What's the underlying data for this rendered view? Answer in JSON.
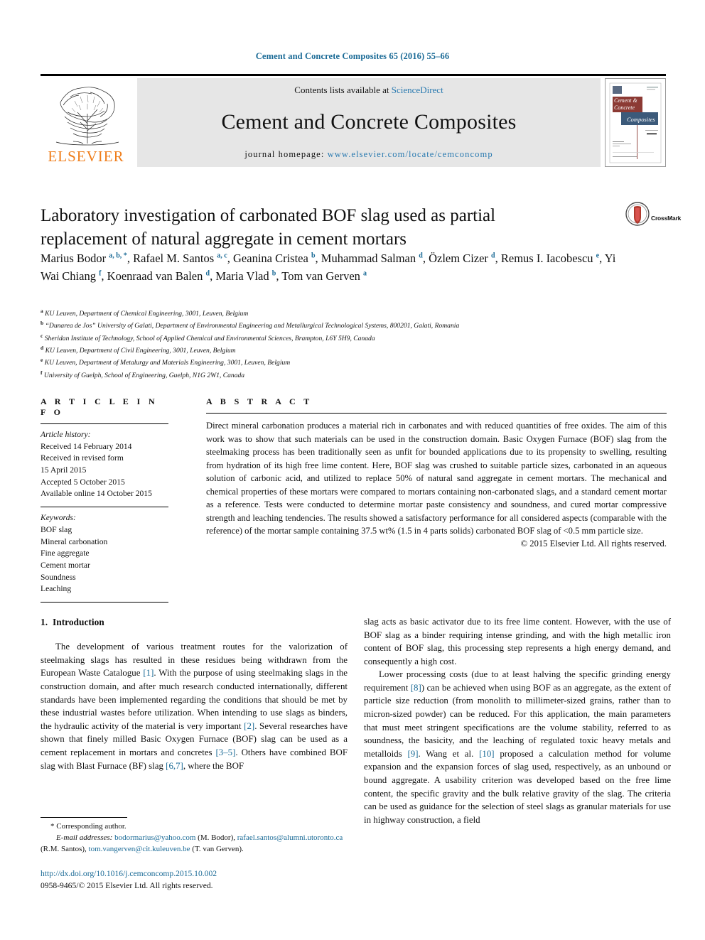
{
  "running_head": "Cement and Concrete Composites 65 (2016) 55–66",
  "masthead": {
    "publisher": "ELSEVIER",
    "contents_prefix": "Contents lists available at ",
    "contents_link": "ScienceDirect",
    "journal_title": "Cement and Concrete Composites",
    "homepage_prefix": "journal homepage: ",
    "homepage_url": "www.elsevier.com/locate/cemconcomp",
    "cover_line1": "Cement &",
    "cover_line2": "Concrete",
    "cover_line3": "Composites"
  },
  "article": {
    "title": "Laboratory investigation of carbonated BOF slag used as partial replacement of natural aggregate in cement mortars",
    "crossmark_label": "CrossMark",
    "authors_html": "Marius Bodor <sup>a, b, *</sup>, Rafael M. Santos <sup>a, c</sup>, Geanina Cristea <sup>b</sup>, Muhammad Salman <sup>d</sup>, Özlem Cizer <sup>d</sup>, Remus I. Iacobescu <sup>e</sup>, Yi Wai Chiang <sup>f</sup>, Koenraad van Balen <sup>d</sup>, Maria Vlad <sup>b</sup>, Tom van Gerven <sup>a</sup>",
    "affiliations": [
      {
        "marker": "a",
        "text": "KU Leuven, Department of Chemical Engineering, 3001, Leuven, Belgium"
      },
      {
        "marker": "b",
        "text": "“Dunarea de Jos” University of Galati, Department of Environmental Engineering and Metallurgical Technological Systems, 800201, Galati, Romania"
      },
      {
        "marker": "c",
        "text": "Sheridan Institute of Technology, School of Applied Chemical and Environmental Sciences, Brampton, L6Y 5H9, Canada"
      },
      {
        "marker": "d",
        "text": "KU Leuven, Department of Civil Engineering, 3001, Leuven, Belgium"
      },
      {
        "marker": "e",
        "text": "KU Leuven, Department of Metalurgy and Materials Engineering, 3001, Leuven, Belgium"
      },
      {
        "marker": "f",
        "text": "University of Guelph, School of Engineering, Guelph, N1G 2W1, Canada"
      }
    ]
  },
  "article_info": {
    "heading": "A R T I C L E   I N F O",
    "history_label": "Article history:",
    "history_lines": [
      "Received 14 February 2014",
      "Received in revised form",
      "15 April 2015",
      "Accepted 5 October 2015",
      "Available online 14 October 2015"
    ],
    "keywords_label": "Keywords:",
    "keywords": [
      "BOF slag",
      "Mineral carbonation",
      "Fine aggregate",
      "Cement mortar",
      "Soundness",
      "Leaching"
    ]
  },
  "abstract": {
    "heading": "A B S T R A C T",
    "text": "Direct mineral carbonation produces a material rich in carbonates and with reduced quantities of free oxides. The aim of this work was to show that such materials can be used in the construction domain. Basic Oxygen Furnace (BOF) slag from the steelmaking process has been traditionally seen as unfit for bounded applications due to its propensity to swelling, resulting from hydration of its high free lime content. Here, BOF slag was crushed to suitable particle sizes, carbonated in an aqueous solution of carbonic acid, and utilized to replace 50% of natural sand aggregate in cement mortars. The mechanical and chemical properties of these mortars were compared to mortars containing non-carbonated slags, and a standard cement mortar as a reference. Tests were conducted to determine mortar paste consistency and soundness, and cured mortar compressive strength and leaching tendencies. The results showed a satisfactory performance for all considered aspects (comparable with the reference) of the mortar sample containing 37.5 wt% (1.5 in 4 parts solids) carbonated BOF slag of <0.5 mm particle size.",
    "copyright": "© 2015 Elsevier Ltd. All rights reserved."
  },
  "body": {
    "section_number": "1.",
    "section_title": "Introduction",
    "left_paragraph_html": "The development of various treatment routes for the valorization of steelmaking slags has resulted in these residues being withdrawn from the European Waste Catalogue <span class=\"ref\">[1]</span>. With the purpose of using steelmaking slags in the construction domain, and after much research conducted internationally, different standards have been implemented regarding the conditions that should be met by these industrial wastes before utilization. When intending to use slags as binders, the hydraulic activity of the material is very important <span class=\"ref\">[2]</span>. Several researches have shown that finely milled Basic Oxygen Furnace (BOF) slag can be used as a cement replacement in mortars and concretes <span class=\"ref\">[3–5]</span>. Others have combined BOF slag with Blast Furnace (BF) slag <span class=\"ref\">[6,7]</span>, where the BOF",
    "right_paragraph1_html": "slag acts as basic activator due to its free lime content. However, with the use of BOF slag as a binder requiring intense grinding, and with the high metallic iron content of BOF slag, this processing step represents a high energy demand, and consequently a high cost.",
    "right_paragraph2_html": "Lower processing costs (due to at least halving the specific grinding energy requirement <span class=\"ref\">[8]</span>) can be achieved when using BOF as an aggregate, as the extent of particle size reduction (from monolith to millimeter-sized grains, rather than to micron-sized powder) can be reduced. For this application, the main parameters that must meet stringent specifications are the volume stability, referred to as soundness, the basicity, and the leaching of regulated toxic heavy metals and metalloids <span class=\"ref\">[9]</span>. Wang et al. <span class=\"ref\">[10]</span> proposed a calculation method for volume expansion and the expansion forces of slag used, respectively, as an unbound or bound aggregate. A usability criterion was developed based on the free lime content, the specific gravity and the bulk relative gravity of the slag. The criteria can be used as guidance for the selection of steel slags as granular materials for use in highway construction, a field"
  },
  "footnote": {
    "corresponding": "* Corresponding author.",
    "email_label": "E-mail addresses:",
    "email1": "bodormarius@yahoo.com",
    "email1_owner": "(M. Bodor),",
    "email2": "rafael.santos@alumni.utoronto.ca",
    "email2_owner": "(R.M. Santos),",
    "email3": "tom.vangerven@cit.kuleuven.be",
    "email3_owner": "(T. van Gerven)."
  },
  "bottom": {
    "doi": "http://dx.doi.org/10.1016/j.cemconcomp.2015.10.002",
    "issn_line": "0958-9465/© 2015 Elsevier Ltd. All rights reserved."
  },
  "colors": {
    "link": "#1a6a96",
    "sciencedirect": "#2a7ab0",
    "elsevier_orange": "#ef7d1a",
    "cover_red": "#8c3a34",
    "cover_blue": "#3c5a7a"
  }
}
